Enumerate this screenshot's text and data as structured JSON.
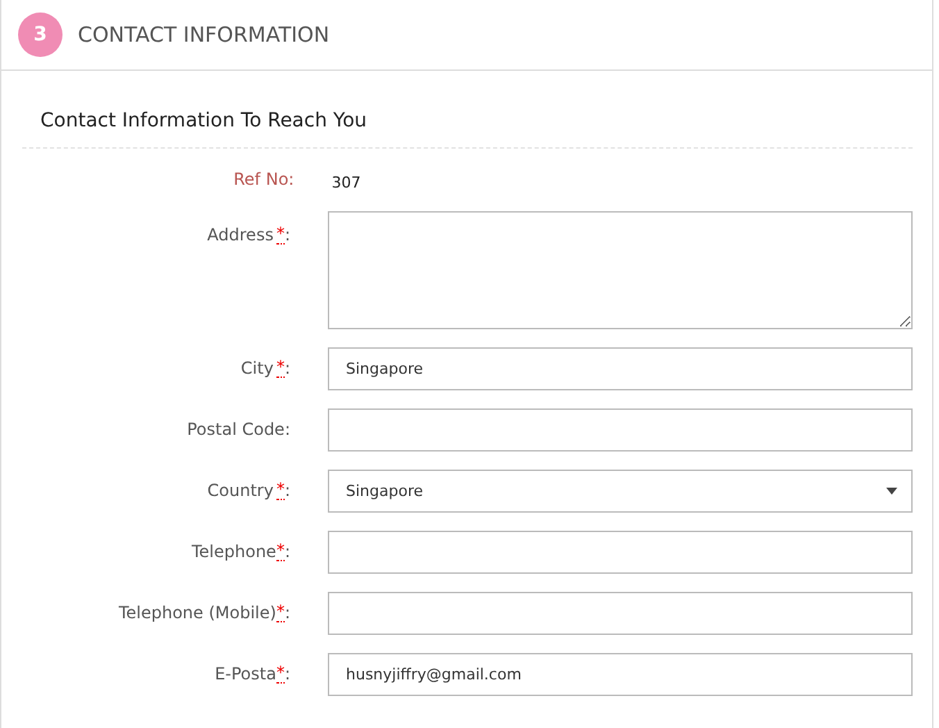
{
  "section": {
    "number": "3",
    "title": "CONTACT INFORMATION"
  },
  "subtitle": "Contact Information To Reach You",
  "fields": [
    {
      "kind": "static",
      "label": "Ref No",
      "label_end": ":",
      "value": "307"
    },
    {
      "kind": "textarea",
      "label": "Address",
      "required_mark": "*",
      "label_end": ":"
    },
    {
      "kind": "text",
      "label": "City",
      "required_mark": "*",
      "label_end": ":",
      "value": "Singapore"
    },
    {
      "kind": "text",
      "label": "Postal Code",
      "label_end": ":"
    },
    {
      "kind": "select",
      "label": "Country",
      "required_mark": "*",
      "label_end": ":",
      "value": "Singapore"
    },
    {
      "kind": "text",
      "label": "Telephone",
      "required_mark": "*",
      "label_end": ":"
    },
    {
      "kind": "text",
      "label": "Telephone (Mobile)",
      "required_mark": "*",
      "label_end": ":"
    },
    {
      "kind": "text",
      "label": "E-Posta",
      "required_mark": "*",
      "label_end": ":",
      "value": "husnyjiffry@gmail.com"
    }
  ]
}
